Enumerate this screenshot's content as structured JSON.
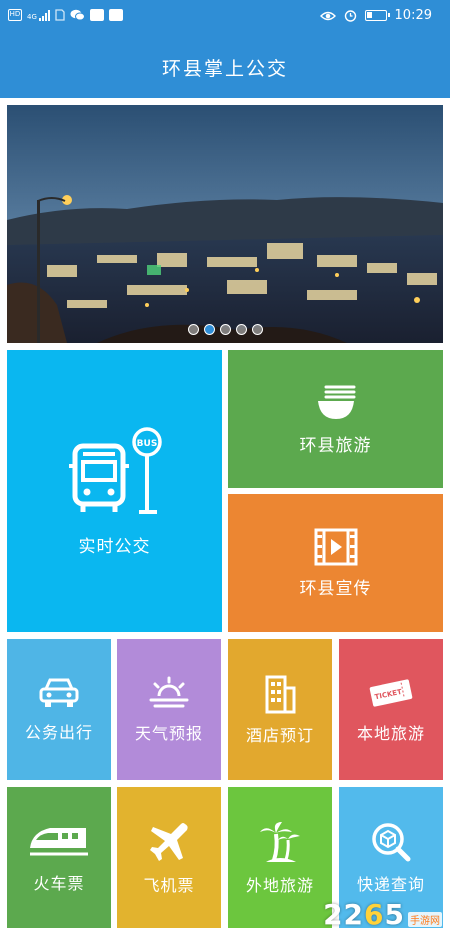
{
  "status_bar": {
    "left_icons": [
      "hd-icon",
      "signal-4g-icon",
      "sim-icon",
      "wechat-icon",
      "app-icon",
      "gallery-icon"
    ],
    "hd_text": "HD",
    "network_text": "4G",
    "time": "10:29"
  },
  "header": {
    "title": "环县掌上公交"
  },
  "banner": {
    "slide_count": 5,
    "active_index": 1
  },
  "tiles": {
    "realtime_bus": {
      "label": "实时公交",
      "color": "#0ab7f0",
      "icon": "bus-stop-icon",
      "bus_sign": "BUS"
    },
    "tourism": {
      "label": "环县旅游",
      "color": "#5ca94e",
      "icon": "bowl-icon"
    },
    "promo": {
      "label": "环县宣传",
      "color": "#ec8632",
      "icon": "film-play-icon"
    },
    "official_travel": {
      "label": "公务出行",
      "color": "#4fb5e6",
      "icon": "car-icon"
    },
    "weather": {
      "label": "天气预报",
      "color": "#b28bd9",
      "icon": "sun-cloud-icon"
    },
    "hotel": {
      "label": "酒店预订",
      "color": "#e2a82e",
      "icon": "building-icon"
    },
    "local_tour": {
      "label": "本地旅游",
      "color": "#e0565e",
      "icon": "ticket-icon",
      "ticket_text": "TICKET"
    },
    "train": {
      "label": "火车票",
      "color": "#5ca94e",
      "icon": "train-icon"
    },
    "flight": {
      "label": "飞机票",
      "color": "#e2b32e",
      "icon": "airplane-icon"
    },
    "outbound_tour": {
      "label": "外地旅游",
      "color": "#6cc63e",
      "icon": "palm-tree-icon"
    },
    "express": {
      "label": "快递查询",
      "color": "#52baec",
      "icon": "package-search-icon"
    }
  },
  "watermark": {
    "num_a": "22",
    "num_b": "6",
    "num_c": "5",
    "sub": "手游网"
  }
}
